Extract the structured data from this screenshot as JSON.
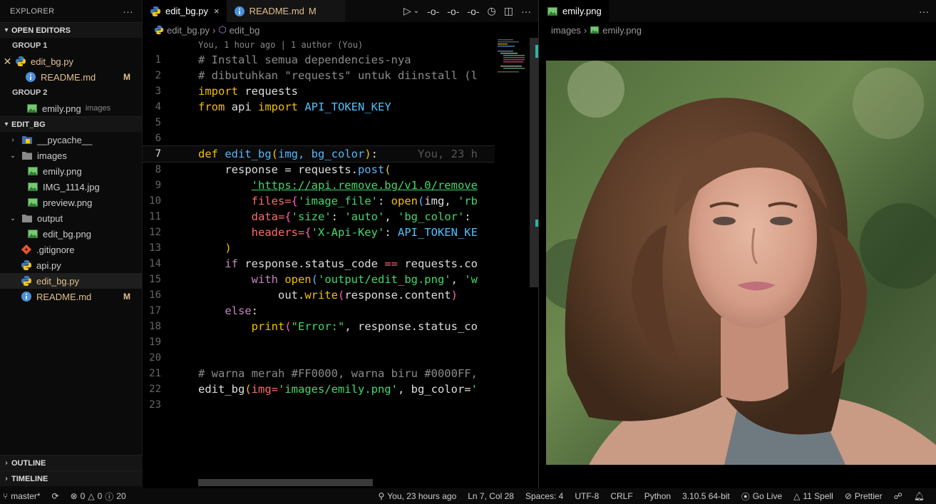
{
  "sidebar": {
    "title": "EXPLORER",
    "more": "···",
    "open_editors": {
      "label": "OPEN EDITORS",
      "group1": "GROUP 1",
      "group1_items": [
        {
          "label": "edit_bg.py",
          "badge": ""
        },
        {
          "label": "README.md",
          "badge": "M"
        }
      ],
      "group2": "GROUP 2",
      "group2_items": [
        {
          "label": "emily.png",
          "desc": "images"
        }
      ]
    },
    "folder": {
      "label": "EDIT_BG",
      "items": [
        {
          "label": "__pycache__"
        },
        {
          "label": "images"
        },
        {
          "label": "emily.png"
        },
        {
          "label": "IMG_1114.jpg"
        },
        {
          "label": "preview.png"
        },
        {
          "label": "output"
        },
        {
          "label": "edit_bg.png"
        },
        {
          "label": ".gitignore"
        },
        {
          "label": "api.py"
        },
        {
          "label": "edit_bg.py"
        },
        {
          "label": "README.md",
          "badge": "M"
        }
      ]
    },
    "outline": "OUTLINE",
    "timeline": "TIMELINE"
  },
  "editor1": {
    "tabs": [
      {
        "label": "edit_bg.py",
        "close": "×"
      },
      {
        "label": "README.md",
        "badge": "M"
      }
    ],
    "breadcrumb": [
      "edit_bg.py",
      "edit_bg"
    ],
    "lens": "You, 1 hour ago | 1 author (You)",
    "blame": "You, 23 h",
    "line_numbers": [
      "1",
      "2",
      "3",
      "4",
      "5",
      "6",
      "7",
      "8",
      "9",
      "10",
      "11",
      "12",
      "13",
      "14",
      "15",
      "16",
      "17",
      "18",
      "19",
      "20",
      "21",
      "22",
      "23"
    ],
    "code": {
      "l1": "# Install semua dependencies-nya",
      "l2": "# dibutuhkan \"requests\" untuk diinstall (l",
      "l3a": "import",
      "l3b": " requests",
      "l4a": "from",
      "l4b": " api ",
      "l4c": "import",
      "l4d": " API_TOKEN_KEY",
      "l7a": "def",
      "l7b": " edit_bg",
      "l7c": "(",
      "l7d": "img, bg_color",
      "l7e": ")",
      "l7f": ":",
      "l8a": "    response = requests.",
      "l8b": "post",
      "l8c": "(",
      "l9a": "        ",
      "l9b": "'https://api.remove.bg/v1.0/remove",
      "l10a": "        files=",
      "l10b": "{",
      "l10c": "'image_file'",
      "l10d": ": ",
      "l10e": "open",
      "l10f": "(",
      "l10g": "img, ",
      "l10h": "'rb",
      "l11a": "        data=",
      "l11b": "{",
      "l11c": "'size'",
      "l11d": ": ",
      "l11e": "'auto'",
      "l11f": ", ",
      "l11g": "'bg_color'",
      "l11h": ": ",
      "l12a": "        headers=",
      "l12b": "{",
      "l12c": "'X-Api-Key'",
      "l12d": ": ",
      "l12e": "API_TOKEN_KE",
      "l13": "    )",
      "l14a": "    if",
      "l14b": " response.status_code ",
      "l14c": "==",
      "l14d": " requests.co",
      "l15a": "        with",
      "l15b": " open",
      "l15c": "(",
      "l15d": "'output/edit_bg.png'",
      "l15e": ", ",
      "l15f": "'w",
      "l16a": "            out.",
      "l16b": "write",
      "l16c": "(",
      "l16d": "response.content",
      "l16e": ")",
      "l17a": "    else",
      "l17b": ":",
      "l18a": "        print",
      "l18b": "(",
      "l18c": "\"Error:\"",
      "l18d": ", response.status_co",
      "l21": "# warna merah #FF0000, warna biru #0000FF,",
      "l22a": "edit_bg",
      "l22b": "(",
      "l22c": "img=",
      "l22d": "'images/emily.png'",
      "l22e": ", bg_color=",
      "l22f": "'"
    }
  },
  "editor2": {
    "tab": "emily.png",
    "breadcrumb": [
      "images",
      "emily.png"
    ]
  },
  "statusbar": {
    "branch": "master*",
    "errors": "0",
    "warnings": "0",
    "info": "20",
    "blame": "You, 23 hours ago",
    "position": "Ln 7, Col 28",
    "spaces": "Spaces: 4",
    "encoding": "UTF-8",
    "eol": "CRLF",
    "language": "Python",
    "interpreter": "3.10.5 64-bit",
    "golive": "Go Live",
    "spell": "11 Spell",
    "prettier": "Prettier"
  }
}
